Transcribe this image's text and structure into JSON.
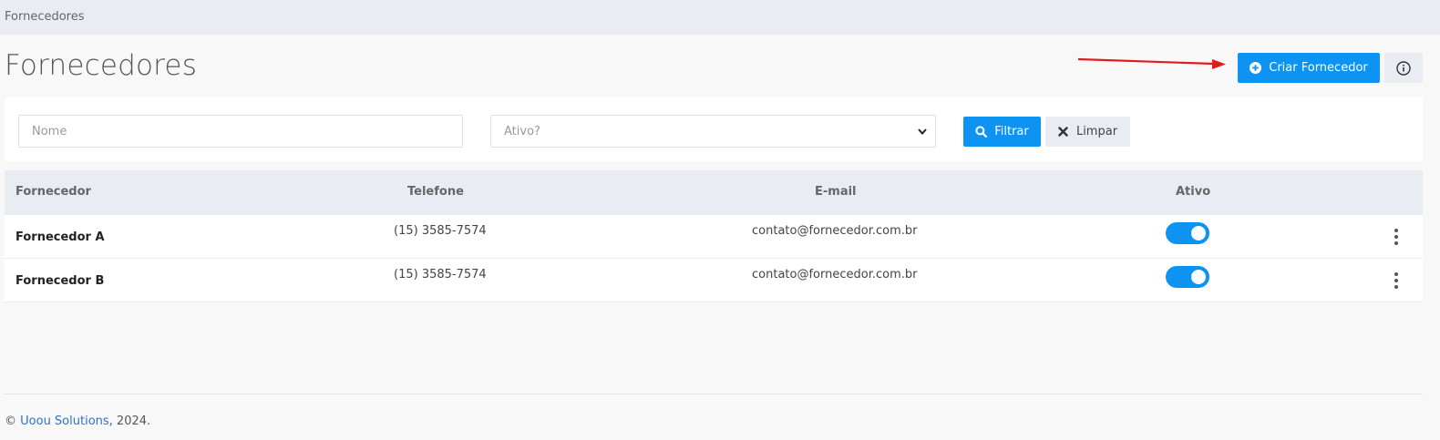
{
  "breadcrumb": "Fornecedores",
  "page_title": "Fornecedores",
  "actions": {
    "create_label": "Criar Fornecedor",
    "create_icon": "plus-circle-icon",
    "info_icon": "info-circle-icon"
  },
  "filters": {
    "name_placeholder": "Nome",
    "name_value": "",
    "active_placeholder": "Ativo?",
    "filter_label": "Filtrar",
    "clear_label": "Limpar"
  },
  "table": {
    "headers": [
      "Fornecedor",
      "Telefone",
      "E-mail",
      "Ativo"
    ],
    "rows": [
      {
        "name": "Fornecedor A",
        "phone": "(15) 3585-7574",
        "email": "contato@fornecedor.com.br",
        "active": true
      },
      {
        "name": "Fornecedor B",
        "phone": "(15) 3585-7574",
        "email": "contato@fornecedor.com.br",
        "active": true
      }
    ]
  },
  "footer": {
    "copyright": "©",
    "company": "Uoou Solutions",
    "year_text": ", 2024."
  },
  "colors": {
    "primary": "#0d93f2",
    "header_bg": "#e9ecf3",
    "annotation_arrow": "#e01b1b"
  }
}
